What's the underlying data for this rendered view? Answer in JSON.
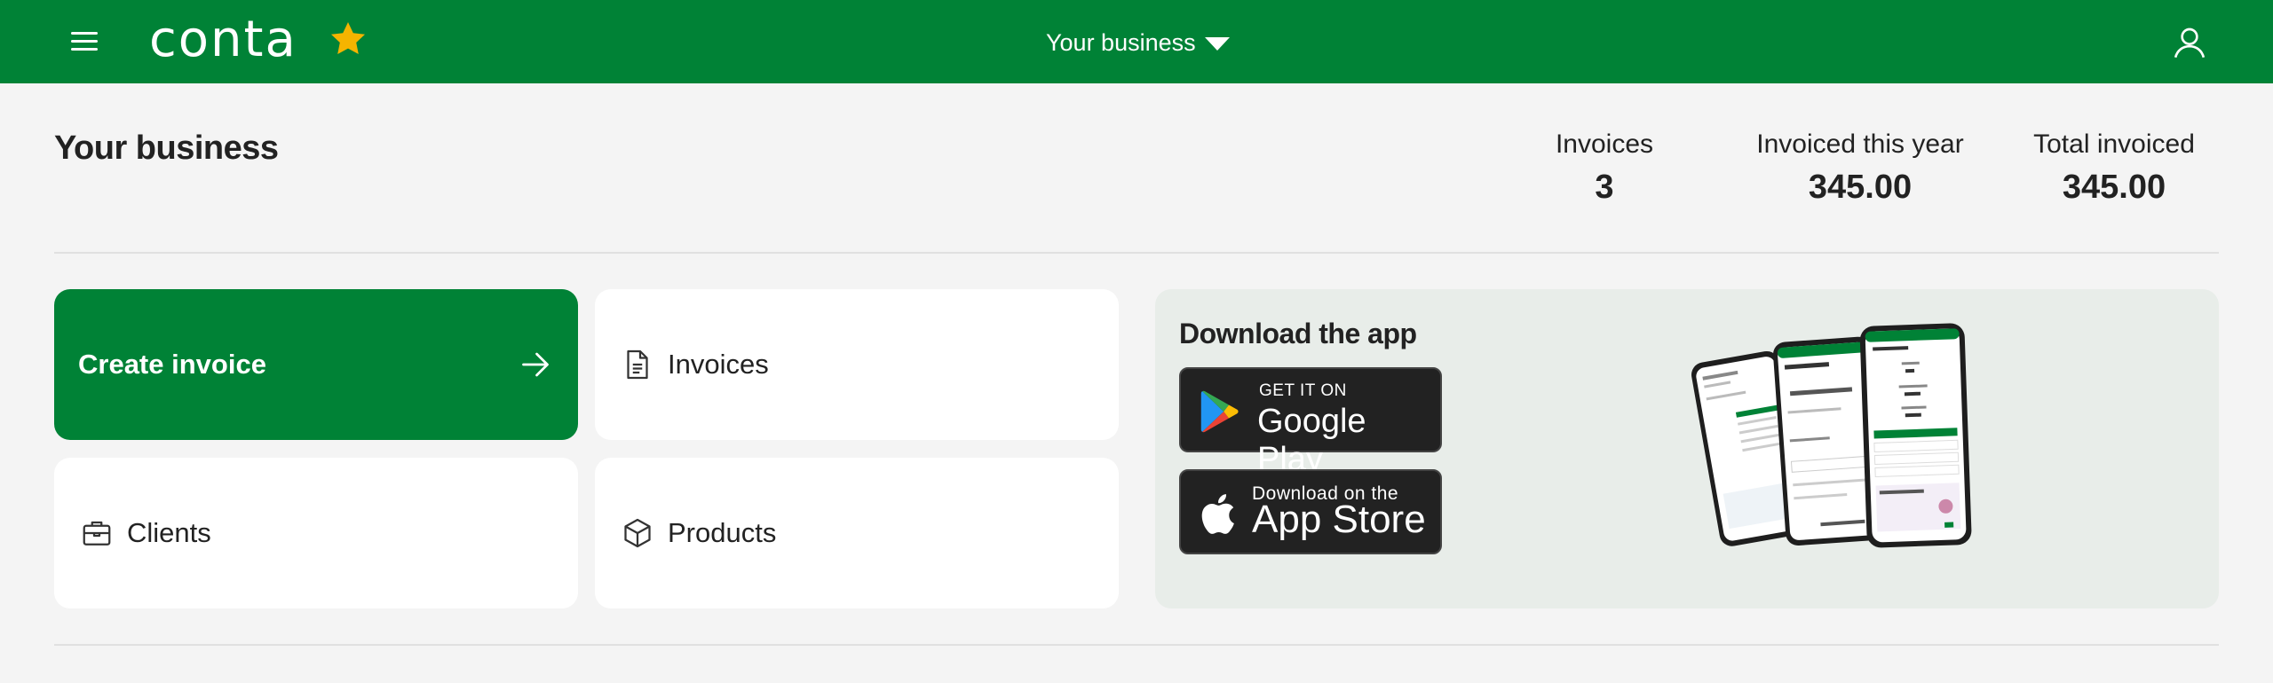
{
  "header": {
    "logo_text": "conta",
    "business_switcher": "Your business",
    "brand_color": "#008236",
    "star_color": "#f5b400"
  },
  "business": {
    "title": "Your business",
    "stats": [
      {
        "label": "Invoices",
        "value": "3"
      },
      {
        "label": "Invoiced this year",
        "value": "345.00"
      },
      {
        "label": "Total invoiced",
        "value": "345.00"
      }
    ]
  },
  "tiles": {
    "create_invoice": "Create invoice",
    "invoices": "Invoices",
    "clients": "Clients",
    "products": "Products"
  },
  "app_download": {
    "title": "Download the app",
    "google_play": {
      "small": "GET IT ON",
      "big": "Google Play"
    },
    "app_store": {
      "small": "Download on the",
      "big": "App Store"
    }
  },
  "icons": [
    "menu-icon",
    "star-icon",
    "caret-down-icon",
    "user-icon",
    "arrow-right-icon",
    "document-icon",
    "briefcase-icon",
    "box-icon",
    "google-play-icon",
    "apple-icon"
  ]
}
